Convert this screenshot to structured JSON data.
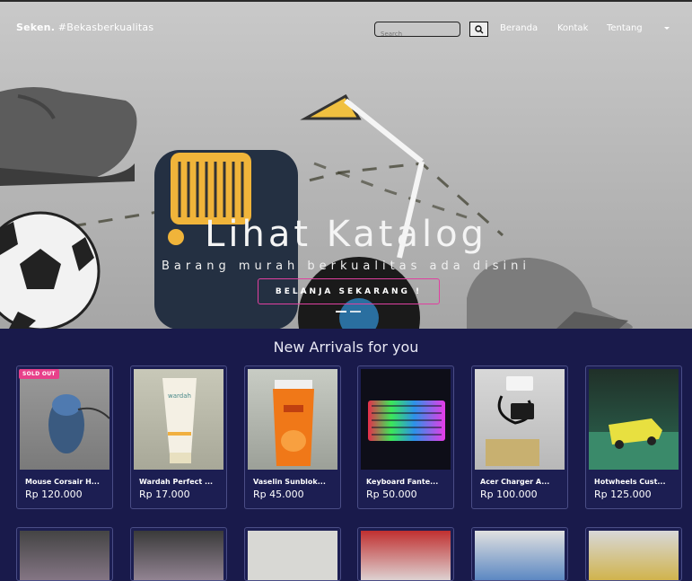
{
  "brand": {
    "name": "Seken.",
    "tagline": " #Bekasberkualitas"
  },
  "search": {
    "placeholder": "Search"
  },
  "nav": {
    "beranda": "Beranda",
    "kontak": "Kontak",
    "tentang": "Tentang"
  },
  "hero": {
    "title": "Lihat Katalog",
    "subtitle": "Barang murah berkualitas ada disini",
    "cta": "BELANJA SEKARANG !"
  },
  "section": {
    "title": "New Arrivals for you"
  },
  "products": [
    {
      "name": "Mouse Corsair H...",
      "price": "Rp 120.000",
      "badge": "SOLD OUT"
    },
    {
      "name": "Wardah Perfect ...",
      "price": "Rp 17.000"
    },
    {
      "name": "Vaselin Sunblok...",
      "price": "Rp 45.000"
    },
    {
      "name": "Keyboard Fante...",
      "price": "Rp 50.000"
    },
    {
      "name": "Acer Charger A...",
      "price": "Rp 100.000"
    },
    {
      "name": "Hotwheels Cust...",
      "price": "Rp 125.000"
    }
  ],
  "colors": {
    "background": "#191a4b",
    "accent": "#e8408a",
    "card_border": "#4a4d86"
  },
  "icons": {
    "search": "search-icon",
    "dropdown": "chevron-down-icon"
  }
}
